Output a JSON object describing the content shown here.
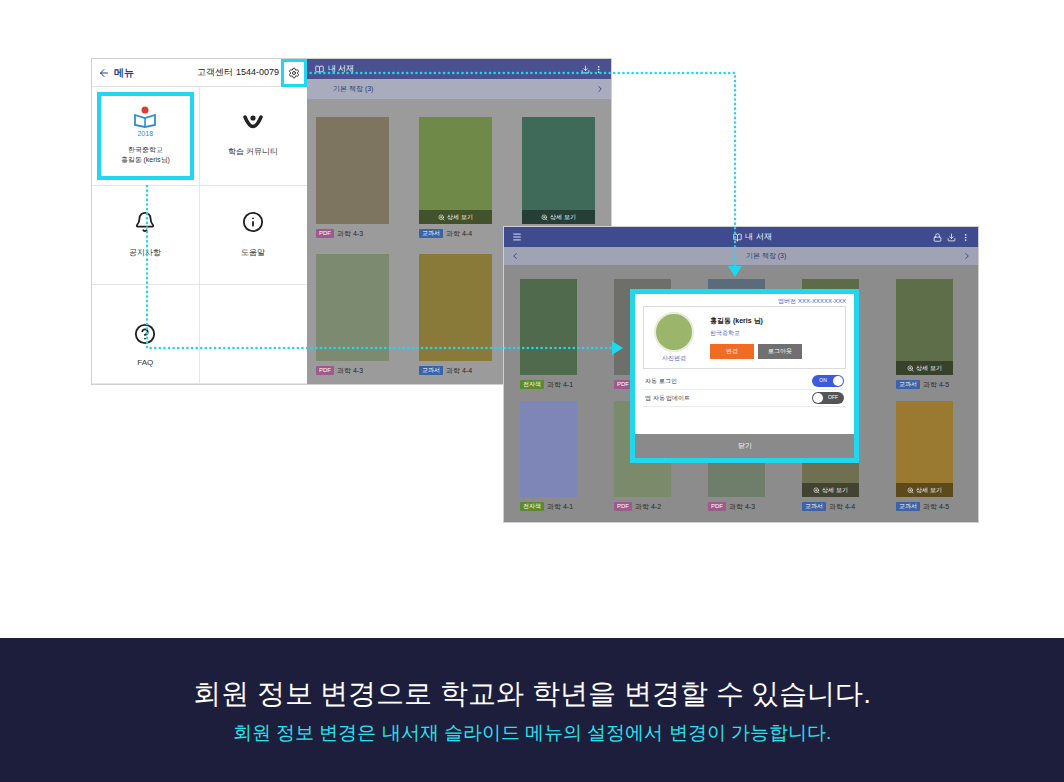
{
  "caption": {
    "title": "회원 정보 변경으로 학교와 학년을 변경할 수 있습니다.",
    "subtitle": "회원 정보 변경은 내서재 슬라이드 메뉴의 설정에서 변경이 가능합니다."
  },
  "menu_window": {
    "header": {
      "title": "메뉴",
      "support": "고객센터 1544-0079",
      "settings_highlighted": true
    },
    "profile": {
      "year": "2018",
      "school": "한국중학교",
      "user": "홍길동 (keris님)",
      "highlighted": true
    },
    "items": [
      {
        "label": "학습 커뮤니티"
      },
      {
        "label": "공지사항"
      },
      {
        "label": "도움말"
      },
      {
        "label": "FAQ"
      }
    ],
    "shelf": {
      "title": "내 서재",
      "shelf_name": "기본 책장 (3)",
      "books": [
        {
          "badge": "PDF",
          "badge_color": "#9c5a8e",
          "label": "과학 4-3",
          "cover": "#7d7560",
          "detail": ""
        },
        {
          "badge": "교과서",
          "badge_color": "#3b63a8",
          "label": "과학 4-4",
          "cover": "#6f8a48",
          "detail": "상세 보기"
        },
        {
          "badge": "",
          "badge_color": "#3b63a8",
          "label": "",
          "cover": "#3f6a5a",
          "detail": "상세 보기"
        },
        {
          "badge": "PDF",
          "badge_color": "#9c5a8e",
          "label": "과학 4-3",
          "cover": "#7c8a70",
          "detail": ""
        },
        {
          "badge": "교과서",
          "badge_color": "#3b63a8",
          "label": "과학 4-4",
          "cover": "#8a7a3a",
          "detail": ""
        }
      ]
    }
  },
  "library_window": {
    "title": "내 서재",
    "shelf_name": "기본 책장 (3)",
    "books": [
      {
        "badge": "전자책",
        "badge_color": "#5c8a2e",
        "label": "과학 4-1",
        "cover": "#4f6a4c",
        "detail": ""
      },
      {
        "badge": "PDF",
        "badge_color": "#9c5a8e",
        "label": "",
        "cover": "#6e6e6a",
        "detail": ""
      },
      {
        "badge": "",
        "badge_color": "#3b63a8",
        "label": "",
        "cover": "#5b6b7a",
        "detail": ""
      },
      {
        "badge": "",
        "badge_color": "#3b63a8",
        "label": "",
        "cover": "#5e6b48",
        "detail": ""
      },
      {
        "badge": "교과서",
        "badge_color": "#3b63a8",
        "label": "과학 4-5",
        "cover": "#5e6e48",
        "detail": "상세 보기"
      },
      {
        "badge": "전자책",
        "badge_color": "#5c8a2e",
        "label": "과학 4-1",
        "cover": "#7e86b8",
        "detail": ""
      },
      {
        "badge": "PDF",
        "badge_color": "#9c5a8e",
        "label": "과학 4-2",
        "cover": "#7a8a6a",
        "detail": ""
      },
      {
        "badge": "PDF",
        "badge_color": "#9c5a8e",
        "label": "과학 4-3",
        "cover": "#6e7e6a",
        "detail": ""
      },
      {
        "badge": "교과서",
        "badge_color": "#3b63a8",
        "label": "과학 4-4",
        "cover": "#6e7050",
        "detail": "상세 보기"
      },
      {
        "badge": "교과서",
        "badge_color": "#3b63a8",
        "label": "과학 4-5",
        "cover": "#9a7a30",
        "detail": "상세 보기"
      }
    ],
    "settings_popup": {
      "highlighted": true,
      "version": "앱버전 XXX-XXXXX-XXX",
      "photo_label": "사진변경",
      "name": "홍길동 (keris 님)",
      "school": "한국중학교",
      "buttons": [
        {
          "label": "변경",
          "color": "#f26b22"
        },
        {
          "label": "로그아웃",
          "color": "#707070"
        }
      ],
      "toggles": [
        {
          "label": "자동 로그인",
          "on": true,
          "reading": "ON"
        },
        {
          "label": "앱 자동 업데이트",
          "on": false,
          "reading": "OFF"
        }
      ],
      "close": "닫기"
    }
  }
}
